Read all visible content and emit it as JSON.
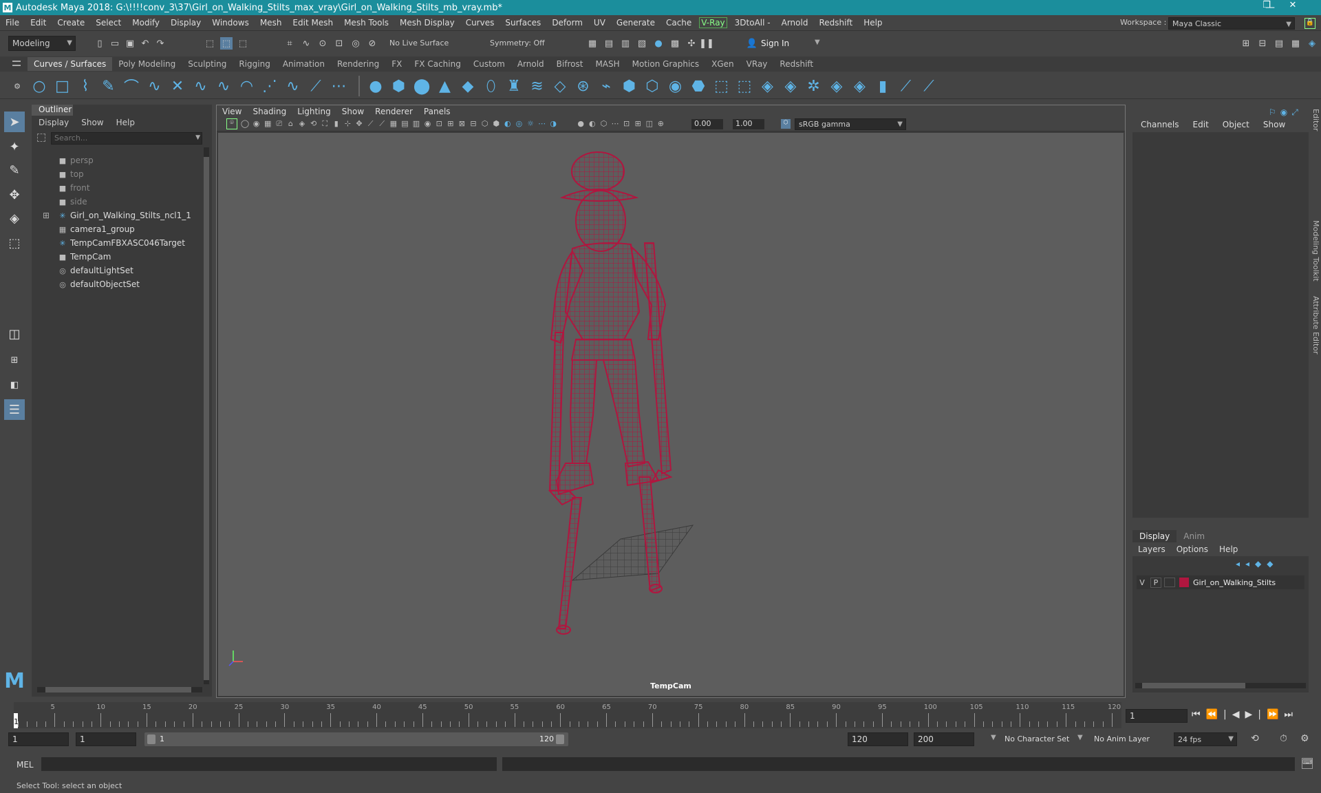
{
  "titlebar": {
    "title": "Autodesk Maya 2018: G:\\!!!!conv_3\\37\\Girl_on_Walking_Stilts_max_vray\\Girl_on_Walking_Stilts_mb_vray.mb*",
    "logo": "M",
    "minimize": "—",
    "maximize": "❐",
    "close": "✕"
  },
  "menubar": {
    "items": [
      "File",
      "Edit",
      "Create",
      "Select",
      "Modify",
      "Display",
      "Windows",
      "Mesh",
      "Edit Mesh",
      "Mesh Tools",
      "Mesh Display",
      "Curves",
      "Surfaces",
      "Deform",
      "UV",
      "Generate",
      "Cache"
    ],
    "vray": "V-Ray",
    "items2": [
      "3DtoAll -",
      "Arnold",
      "Redshift",
      "Help"
    ],
    "workspace_label": "Workspace :",
    "workspace_value": "Maya Classic"
  },
  "statusline": {
    "mode": "Modeling",
    "live_surface": "No Live Surface",
    "symmetry": "Symmetry: Off",
    "sign_in": "Sign In"
  },
  "shelf": {
    "tabs": [
      "Curves / Surfaces",
      "Poly Modeling",
      "Sculpting",
      "Rigging",
      "Animation",
      "Rendering",
      "FX",
      "FX Caching",
      "Custom",
      "Arnold",
      "Bifrost",
      "MASH",
      "Motion Graphics",
      "XGen",
      "VRay",
      "Redshift"
    ],
    "active": 0
  },
  "outliner": {
    "title": "Outliner",
    "menus": [
      "Display",
      "Show",
      "Help"
    ],
    "search_placeholder": "Search...",
    "items": [
      {
        "label": "persp",
        "icon": "camera-icon",
        "dim": true
      },
      {
        "label": "top",
        "icon": "camera-icon",
        "dim": true
      },
      {
        "label": "front",
        "icon": "camera-icon",
        "dim": true
      },
      {
        "label": "side",
        "icon": "camera-icon",
        "dim": true
      },
      {
        "label": "Girl_on_Walking_Stilts_ncl1_1",
        "icon": "joint-icon",
        "dim": false,
        "expand": "⊞"
      },
      {
        "label": "camera1_group",
        "icon": "group-icon",
        "dim": false
      },
      {
        "label": "TempCamFBXASC046Target",
        "icon": "joint-icon",
        "dim": false
      },
      {
        "label": "TempCam",
        "icon": "camera-icon",
        "dim": false
      },
      {
        "label": "defaultLightSet",
        "icon": "set-icon",
        "dim": false
      },
      {
        "label": "defaultObjectSet",
        "icon": "set-icon",
        "dim": false
      }
    ]
  },
  "viewport": {
    "menus": [
      "View",
      "Shading",
      "Lighting",
      "Show",
      "Renderer",
      "Panels"
    ],
    "near": "0.00",
    "far": "1.00",
    "color_space": "sRGB gamma",
    "camera": "TempCam",
    "wire_color": "#b0163f"
  },
  "channelbox": {
    "menus": [
      "Channels",
      "Edit",
      "Object",
      "Show"
    ]
  },
  "layers": {
    "tabs": [
      "Display",
      "Anim"
    ],
    "menus": [
      "Layers",
      "Options",
      "Help"
    ],
    "layer": {
      "v": "V",
      "p": "P",
      "name": "Girl_on_Walking_Stilts",
      "color": "#b0163f"
    }
  },
  "side_tabs": [
    "Channel Box / Layer Editor",
    "Modeling Toolkit",
    "Attribute Editor"
  ],
  "timeline": {
    "ticks": [
      "5",
      "10",
      "15",
      "20",
      "25",
      "30",
      "35",
      "40",
      "45",
      "50",
      "55",
      "60",
      "65",
      "70",
      "75",
      "80",
      "85",
      "90",
      "95",
      "100",
      "105",
      "110",
      "115",
      "120"
    ],
    "start_marker": "1",
    "current_frame": "1"
  },
  "range": {
    "start": "1",
    "inner_start": "1",
    "slider_start": "1",
    "slider_end": "120",
    "end": "120",
    "anim_end": "200",
    "char_set": "No Character Set",
    "anim_layer": "No Anim Layer",
    "fps": "24 fps"
  },
  "cmdline": {
    "label": "MEL"
  },
  "helpline": {
    "text": "Select Tool: select an object"
  }
}
